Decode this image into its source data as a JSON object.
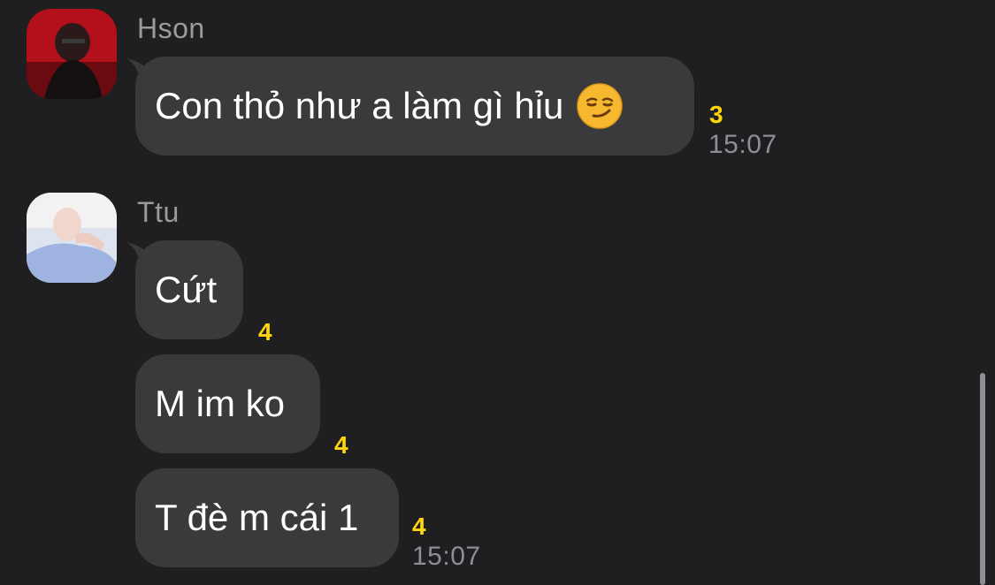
{
  "messages": [
    {
      "sender": "Hson",
      "text": "Con thỏ như a làm gì hỉu",
      "count": "3",
      "time": "15:07",
      "emoji": "smirk-emoji"
    },
    {
      "sender": "Ttu",
      "text": "Cứt",
      "count": "4"
    },
    {
      "text": "M im ko",
      "count": "4"
    },
    {
      "text": "T đè m cái 1",
      "count": "4",
      "time": "15:07"
    }
  ],
  "colors": {
    "background": "#1f1f21",
    "bubble": "#3a3a3c",
    "count": "#ffd60a",
    "muted": "#8e8e93"
  }
}
